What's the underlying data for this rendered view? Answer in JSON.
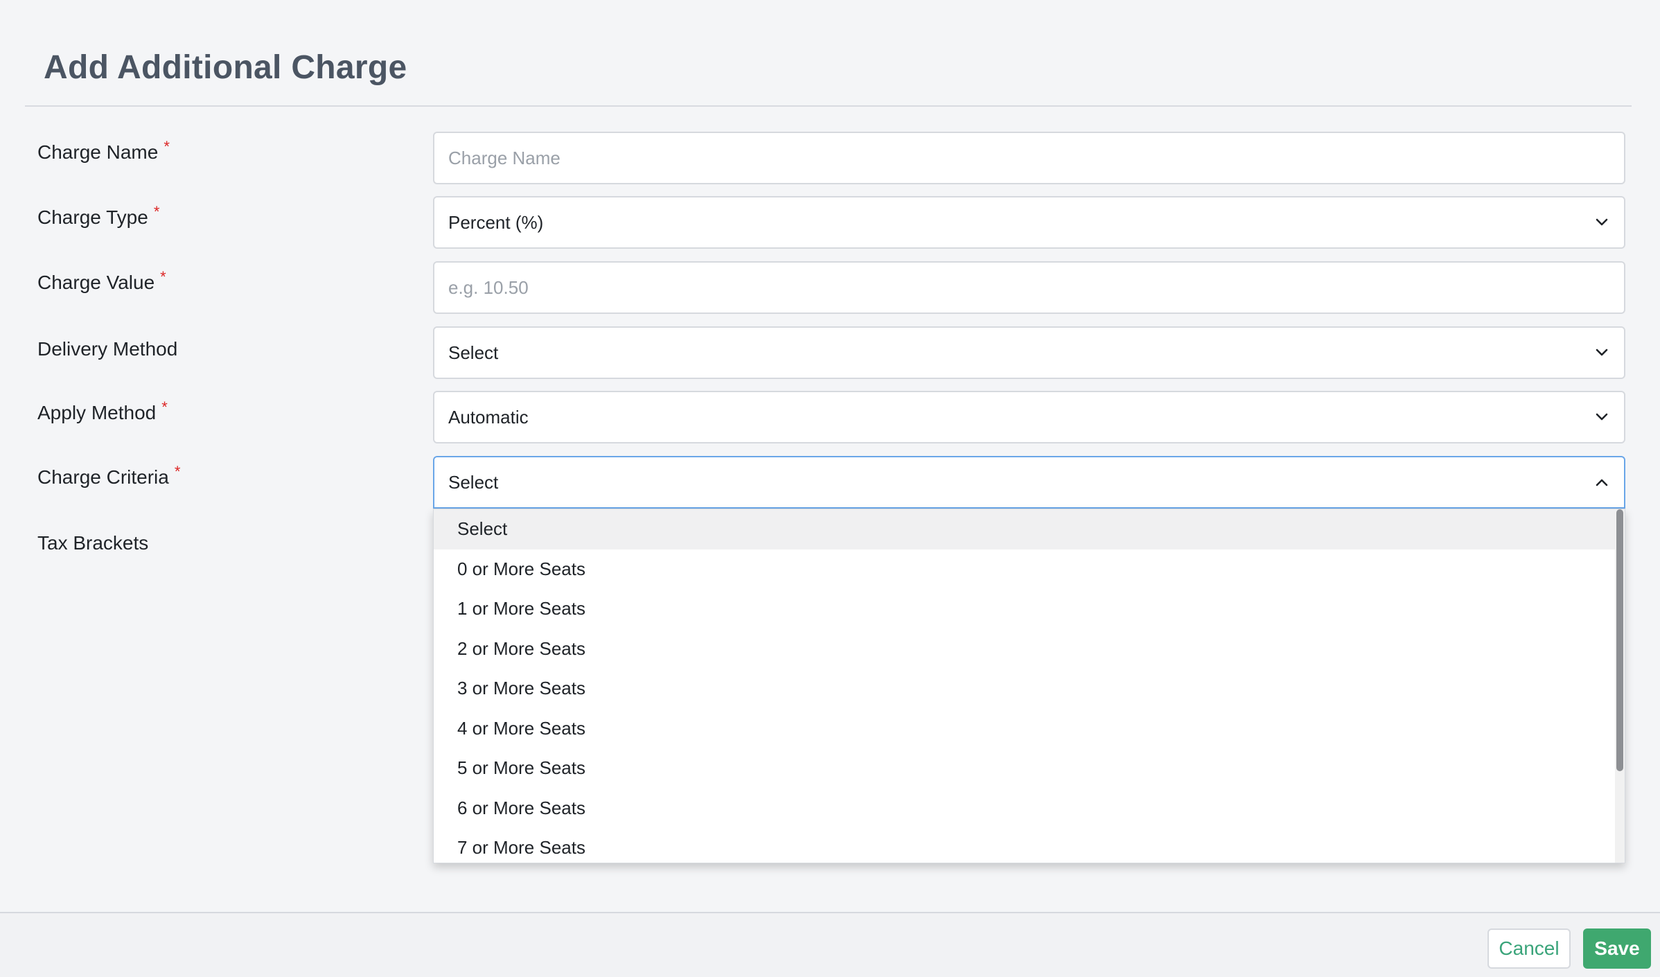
{
  "page": {
    "title": "Add Additional Charge"
  },
  "form": {
    "charge_name": {
      "label": "Charge Name",
      "placeholder": "Charge Name",
      "required": true
    },
    "charge_type": {
      "label": "Charge Type",
      "value": "Percent (%)",
      "required": true
    },
    "charge_value": {
      "label": "Charge Value",
      "placeholder": "e.g. 10.50",
      "required": true
    },
    "delivery_method": {
      "label": "Delivery Method",
      "value": "Select",
      "required": false
    },
    "apply_method": {
      "label": "Apply Method",
      "value": "Automatic",
      "required": true
    },
    "charge_criteria": {
      "label": "Charge Criteria",
      "value": "Select",
      "required": true,
      "open": true,
      "options": [
        "Select",
        "0 or More Seats",
        "1 or More Seats",
        "2 or More Seats",
        "3 or More Seats",
        "4 or More Seats",
        "5 or More Seats",
        "6 or More Seats",
        "7 or More Seats"
      ]
    },
    "tax_brackets": {
      "label": "Tax Brackets"
    }
  },
  "footer": {
    "cancel_label": "Cancel",
    "save_label": "Save"
  },
  "icons": {
    "chevron_down": "chevron-down-icon",
    "chevron_up": "chevron-up-icon",
    "required_marker": "*"
  },
  "colors": {
    "required": "#dc2626",
    "save_button": "#3fa86f",
    "cancel_text": "#3aa47a",
    "focus_border": "#6aa6e8"
  }
}
